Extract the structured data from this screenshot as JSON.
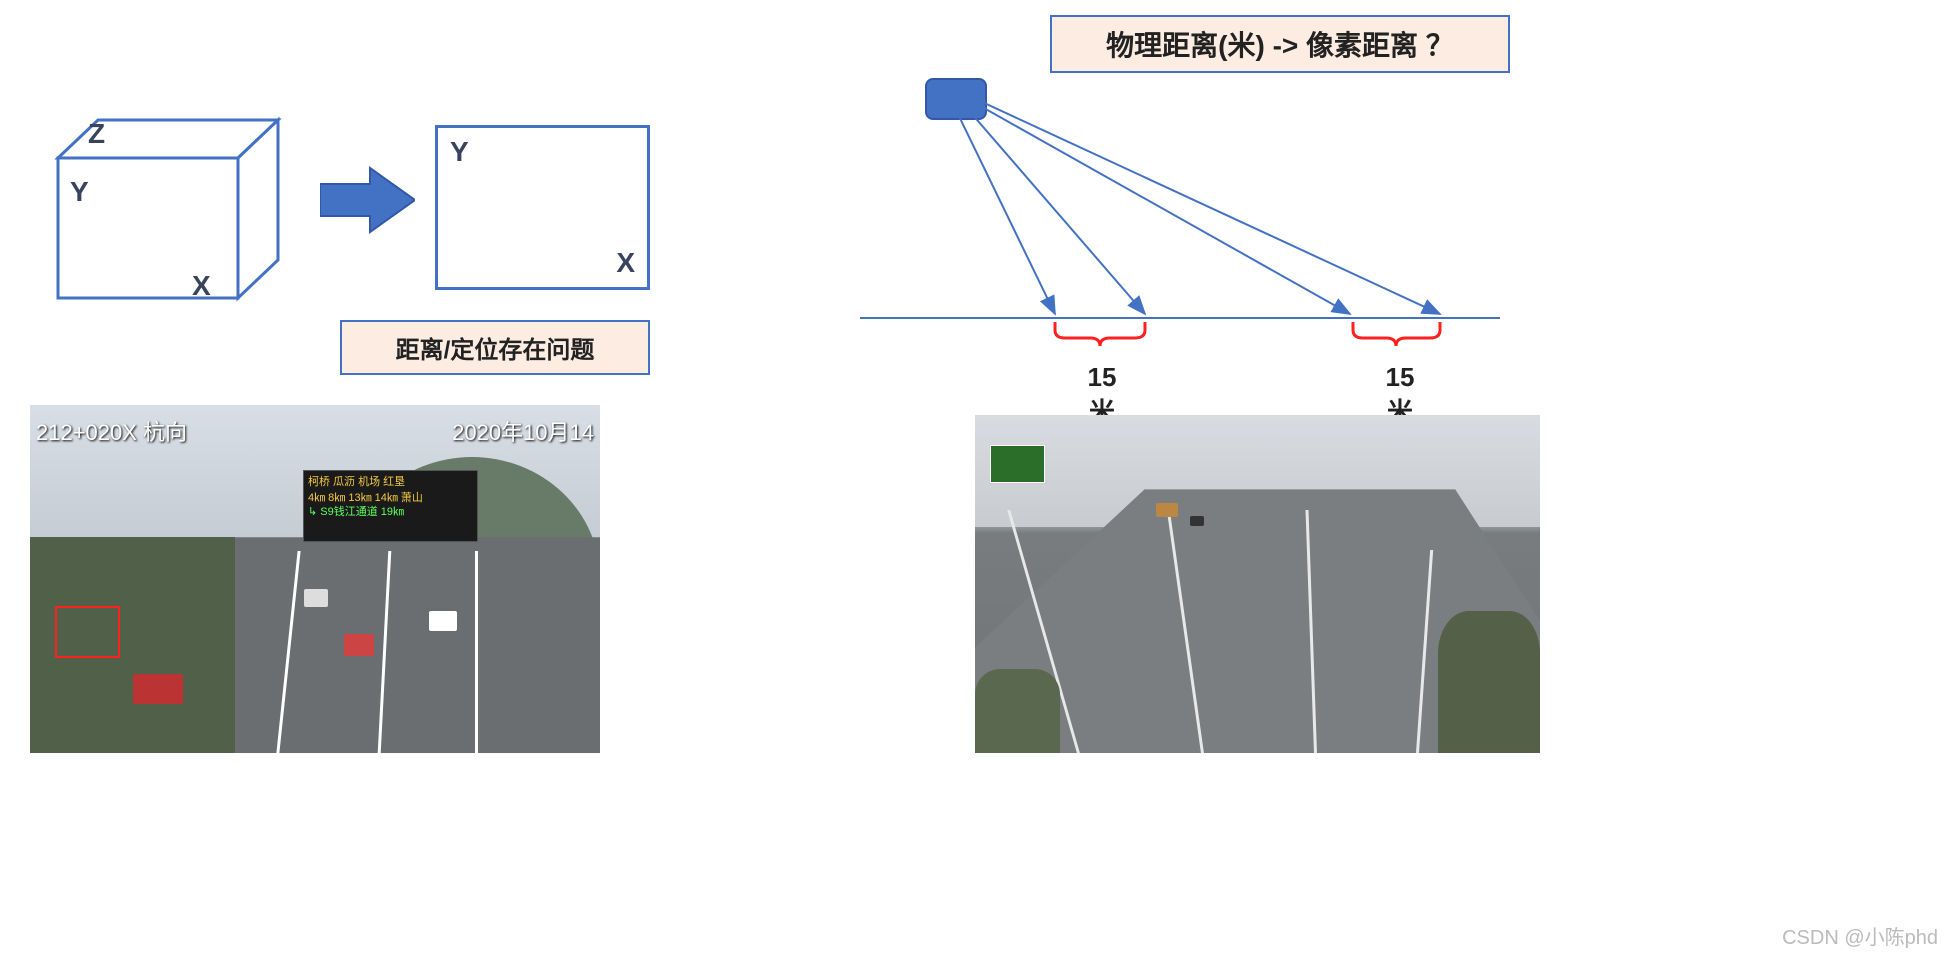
{
  "left": {
    "cube": {
      "z": "Z",
      "y": "Y",
      "x": "X"
    },
    "rect": {
      "y": "Y",
      "x": "X"
    },
    "problem_label": "距离/定位存在问题",
    "photo": {
      "overlay_left": "212+020X 杭向",
      "overlay_right": "2020年10月14",
      "sign_row1": "柯桥 瓜沥 机场 红垦",
      "sign_row2": "4㎞ 8㎞ 13㎞ 14㎞   萧山",
      "sign_row3": "↳ S9钱江通道     19㎞"
    }
  },
  "right": {
    "question_label": "物理距离(米) -> 像素距离 ？",
    "dist1_value": "15",
    "dist1_unit": "米",
    "dist2_value": "15",
    "dist2_unit": "米"
  },
  "watermark": "CSDN @小陈phd"
}
